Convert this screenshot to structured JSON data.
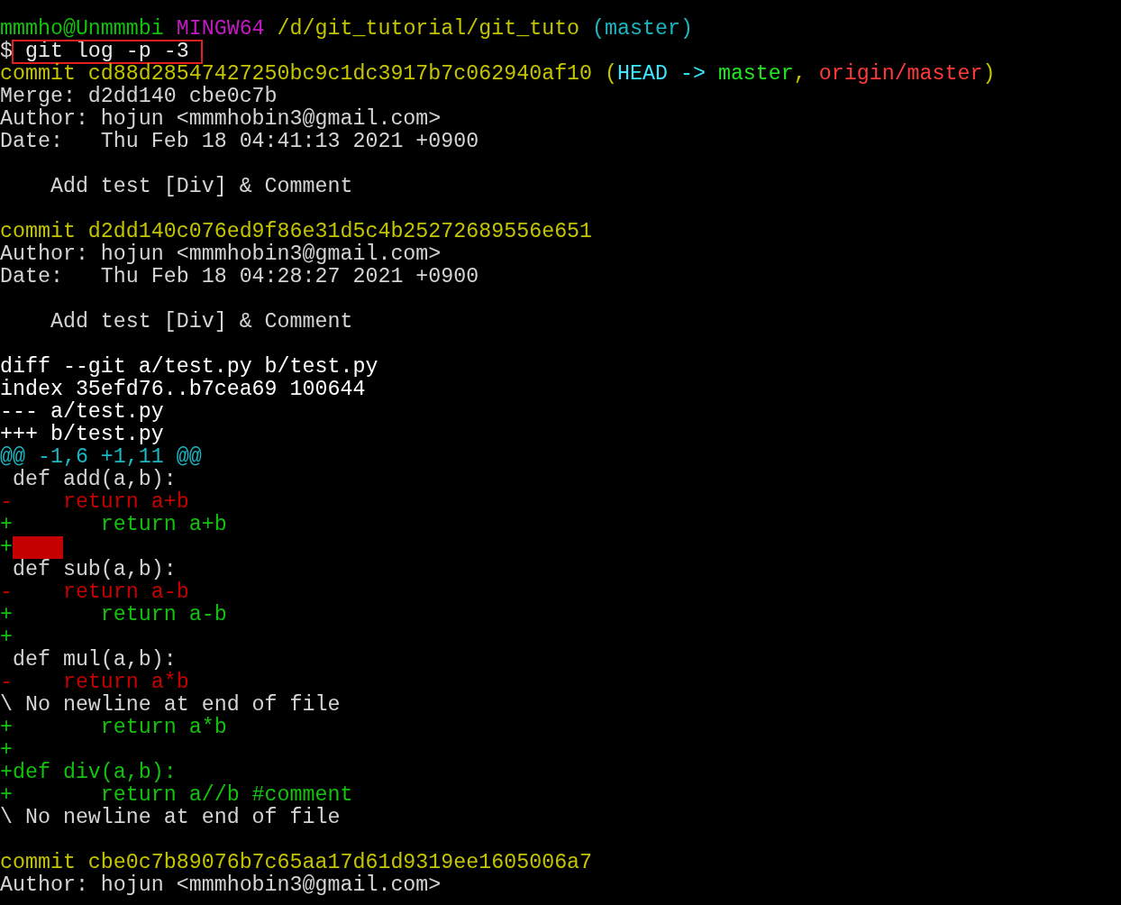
{
  "terminal": {
    "lines": [
      {
        "kind": "text",
        "segments": [
          {
            "text": "mmmho@Unmmmbi",
            "kind": "user"
          },
          {
            "text": " MINGW64",
            "kind": "system"
          },
          {
            "text": " /d/git_tutorial/git_tuto",
            "kind": "path"
          },
          {
            "text": " (master)",
            "kind": "branch"
          }
        ]
      },
      {
        "kind": "text",
        "segments": [
          {
            "text": "$",
            "kind": "plain"
          },
          {
            "text": " git log -p -3",
            "kind": "command",
            "highlighted": true
          }
        ]
      },
      {
        "kind": "text",
        "segments": [
          {
            "text": "commit cd88d28547427250bc9c1dc3917b7c062940af10 (",
            "kind": "commit"
          },
          {
            "text": "HEAD ->",
            "kind": "head"
          },
          {
            "text": " master",
            "kind": "local-branch"
          },
          {
            "text": ",",
            "kind": "commit"
          },
          {
            "text": " origin/master",
            "kind": "remote-branch"
          },
          {
            "text": ")",
            "kind": "commit"
          }
        ]
      },
      {
        "kind": "text",
        "segments": [
          {
            "text": "Merge: d2dd140 cbe0c7b",
            "kind": "plain"
          }
        ]
      },
      {
        "kind": "text",
        "segments": [
          {
            "text": "Author: hojun <mmmhobin3@gmail.com>",
            "kind": "plain"
          }
        ]
      },
      {
        "kind": "text",
        "segments": [
          {
            "text": "Date:   Thu Feb 18 04:41:13 2021 +0900",
            "kind": "plain"
          }
        ]
      },
      {
        "kind": "blank"
      },
      {
        "kind": "text",
        "segments": [
          {
            "text": "    Add test [Div] & Comment",
            "kind": "plain"
          }
        ]
      },
      {
        "kind": "blank"
      },
      {
        "kind": "text",
        "segments": [
          {
            "text": "commit d2dd140c076ed9f86e31d5c4b25272689556e651",
            "kind": "commit"
          }
        ]
      },
      {
        "kind": "text",
        "segments": [
          {
            "text": "Author: hojun <mmmhobin3@gmail.com>",
            "kind": "plain"
          }
        ]
      },
      {
        "kind": "text",
        "segments": [
          {
            "text": "Date:   Thu Feb 18 04:28:27 2021 +0900",
            "kind": "plain"
          }
        ]
      },
      {
        "kind": "blank"
      },
      {
        "kind": "text",
        "segments": [
          {
            "text": "    Add test [Div] & Comment",
            "kind": "plain"
          }
        ]
      },
      {
        "kind": "blank"
      },
      {
        "kind": "text",
        "segments": [
          {
            "text": "diff --git a/test.py b/test.py",
            "kind": "meta"
          }
        ]
      },
      {
        "kind": "text",
        "segments": [
          {
            "text": "index 35efd76..b7cea69 100644",
            "kind": "meta"
          }
        ]
      },
      {
        "kind": "text",
        "segments": [
          {
            "text": "--- a/test.py",
            "kind": "meta"
          }
        ]
      },
      {
        "kind": "text",
        "segments": [
          {
            "text": "+++ b/test.py",
            "kind": "meta"
          }
        ]
      },
      {
        "kind": "text",
        "segments": [
          {
            "text": "@@ -1,6 +1,11 @@",
            "kind": "hunk"
          }
        ]
      },
      {
        "kind": "text",
        "segments": [
          {
            "text": " def add(a,b):",
            "kind": "plain"
          }
        ]
      },
      {
        "kind": "text",
        "segments": [
          {
            "text": "-    return a+b",
            "kind": "removed"
          }
        ]
      },
      {
        "kind": "text",
        "segments": [
          {
            "text": "+       return a+b",
            "kind": "added"
          }
        ]
      },
      {
        "kind": "text",
        "trailing_whitespace": true,
        "segments": [
          {
            "text": "+",
            "kind": "added"
          }
        ]
      },
      {
        "kind": "text",
        "segments": [
          {
            "text": " def sub(a,b):",
            "kind": "plain"
          }
        ]
      },
      {
        "kind": "text",
        "segments": [
          {
            "text": "-    return a-b",
            "kind": "removed"
          }
        ]
      },
      {
        "kind": "text",
        "segments": [
          {
            "text": "+       return a-b",
            "kind": "added"
          }
        ]
      },
      {
        "kind": "text",
        "segments": [
          {
            "text": "+",
            "kind": "added"
          }
        ]
      },
      {
        "kind": "text",
        "segments": [
          {
            "text": " def mul(a,b):",
            "kind": "plain"
          }
        ]
      },
      {
        "kind": "text",
        "segments": [
          {
            "text": "-    return a*b",
            "kind": "removed"
          }
        ]
      },
      {
        "kind": "text",
        "segments": [
          {
            "text": "\\ No newline at end of file",
            "kind": "plain"
          }
        ]
      },
      {
        "kind": "text",
        "segments": [
          {
            "text": "+       return a*b",
            "kind": "added"
          }
        ]
      },
      {
        "kind": "text",
        "segments": [
          {
            "text": "+",
            "kind": "added"
          }
        ]
      },
      {
        "kind": "text",
        "segments": [
          {
            "text": "+def div(a,b):",
            "kind": "added"
          }
        ]
      },
      {
        "kind": "text",
        "segments": [
          {
            "text": "+       return a//b #comment",
            "kind": "added"
          }
        ]
      },
      {
        "kind": "text",
        "segments": [
          {
            "text": "\\ No newline at end of file",
            "kind": "plain"
          }
        ]
      },
      {
        "kind": "blank"
      },
      {
        "kind": "text",
        "segments": [
          {
            "text": "commit cbe0c7b89076b7c65aa17d61d9319ee1605006a7",
            "kind": "commit"
          }
        ]
      },
      {
        "kind": "text",
        "segments": [
          {
            "text": "Author: hojun <mmmhobin3@gmail.com>",
            "kind": "plain"
          }
        ]
      }
    ]
  }
}
